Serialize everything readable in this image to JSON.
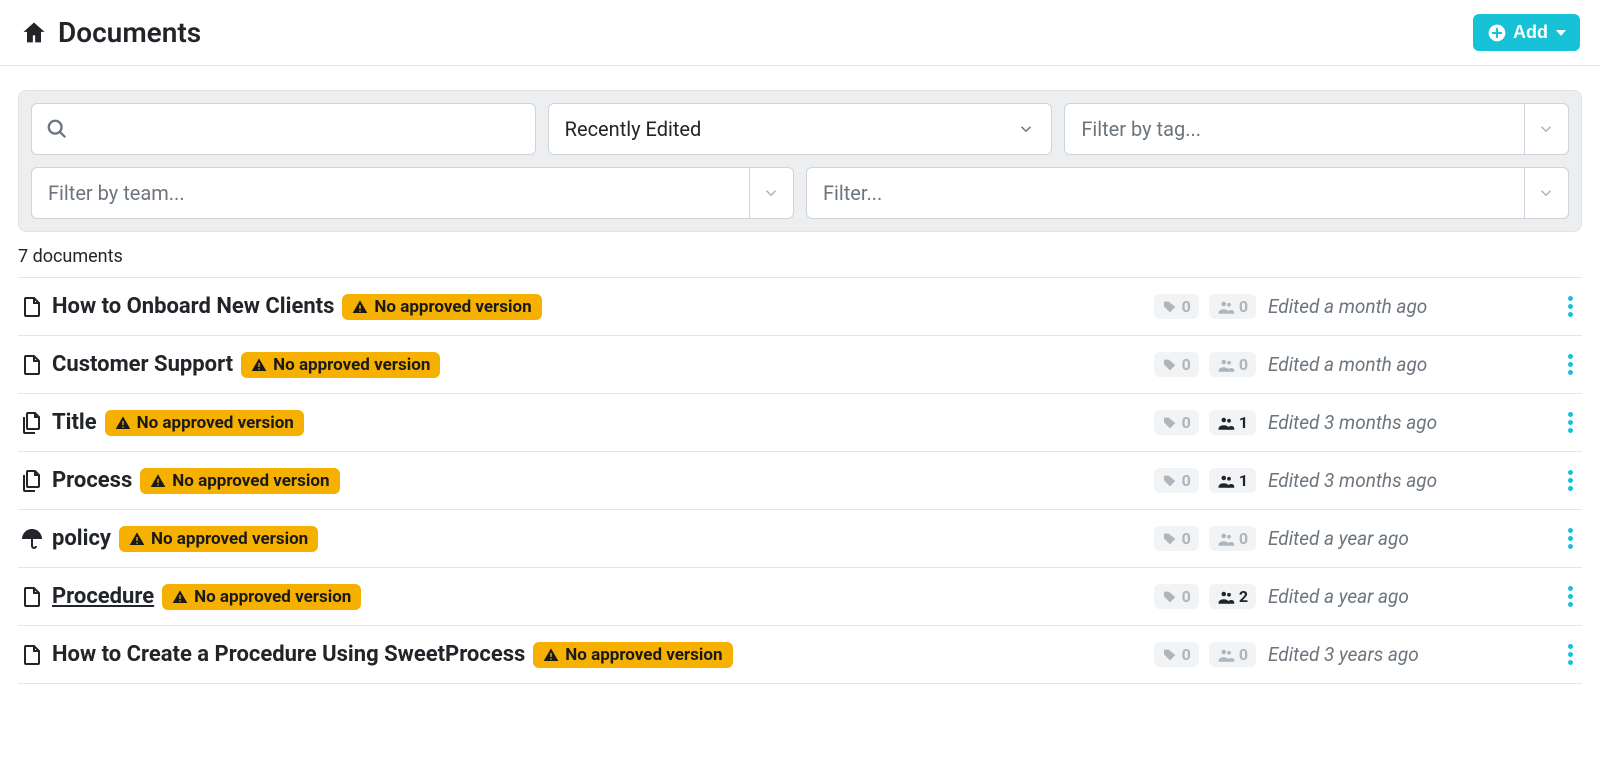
{
  "header": {
    "title": "Documents",
    "add_button_label": "Add"
  },
  "filters": {
    "search_value": "",
    "sort_selected": "Recently Edited",
    "tag_placeholder": "Filter by tag...",
    "team_placeholder": "Filter by team...",
    "generic_placeholder": "Filter..."
  },
  "count_text": "7 documents",
  "badge_text": "No approved version",
  "documents": [
    {
      "icon": "file",
      "title": "How to Onboard New Clients",
      "underline": false,
      "tags": 0,
      "teams": 0,
      "teams_active": false,
      "edited": "Edited a month ago"
    },
    {
      "icon": "file",
      "title": "Customer Support",
      "underline": false,
      "tags": 0,
      "teams": 0,
      "teams_active": false,
      "edited": "Edited a month ago"
    },
    {
      "icon": "files",
      "title": "Title",
      "underline": false,
      "tags": 0,
      "teams": 1,
      "teams_active": true,
      "edited": "Edited 3 months ago"
    },
    {
      "icon": "files",
      "title": "Process",
      "underline": false,
      "tags": 0,
      "teams": 1,
      "teams_active": true,
      "edited": "Edited 3 months ago"
    },
    {
      "icon": "umbrella",
      "title": "policy",
      "underline": false,
      "tags": 0,
      "teams": 0,
      "teams_active": false,
      "edited": "Edited a year ago"
    },
    {
      "icon": "file",
      "title": "Procedure",
      "underline": true,
      "tags": 0,
      "teams": 2,
      "teams_active": true,
      "edited": "Edited a year ago"
    },
    {
      "icon": "file",
      "title": "How to Create a Procedure Using SweetProcess",
      "underline": false,
      "tags": 0,
      "teams": 0,
      "teams_active": false,
      "edited": "Edited 3 years ago"
    }
  ]
}
